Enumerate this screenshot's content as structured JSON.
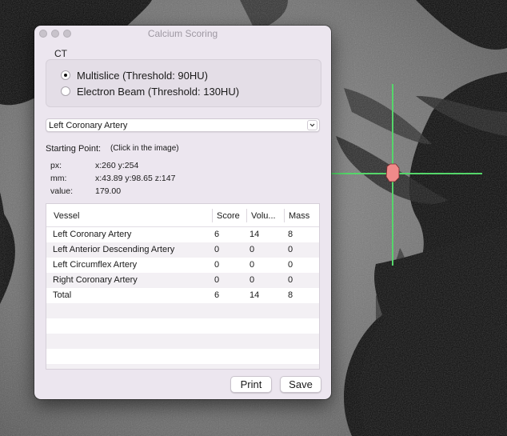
{
  "window": {
    "title": "Calcium Scoring"
  },
  "ct_group": {
    "label": "CT",
    "options": [
      {
        "label": "Multislice (Threshold: 90HU)",
        "selected": true
      },
      {
        "label": "Electron Beam (Threshold: 130HU)",
        "selected": false
      }
    ]
  },
  "vessel_select": {
    "value": "Left Coronary Artery"
  },
  "starting_point": {
    "label": "Starting Point:",
    "hint": "(Click in the image)",
    "px_label": "px:",
    "px_value": "x:260 y:254",
    "mm_label": "mm:",
    "mm_value": "x:43.89 y:98.65 z:147",
    "value_label": "value:",
    "value_value": "179.00"
  },
  "table": {
    "headers": [
      "Vessel",
      "Score",
      "Volu...",
      "Mass"
    ],
    "rows": [
      [
        "Left Coronary Artery",
        "6",
        "14",
        "8"
      ],
      [
        "Left Anterior Descending Artery",
        "0",
        "0",
        "0"
      ],
      [
        "Left Circumflex Artery",
        "0",
        "0",
        "0"
      ],
      [
        "Right Coronary Artery",
        "0",
        "0",
        "0"
      ],
      [
        "Total",
        "6",
        "14",
        "8"
      ]
    ]
  },
  "buttons": {
    "print": "Print",
    "save": "Save"
  },
  "crosshair": {
    "color": "#55d66a",
    "marker_color": "#f08a8a"
  }
}
